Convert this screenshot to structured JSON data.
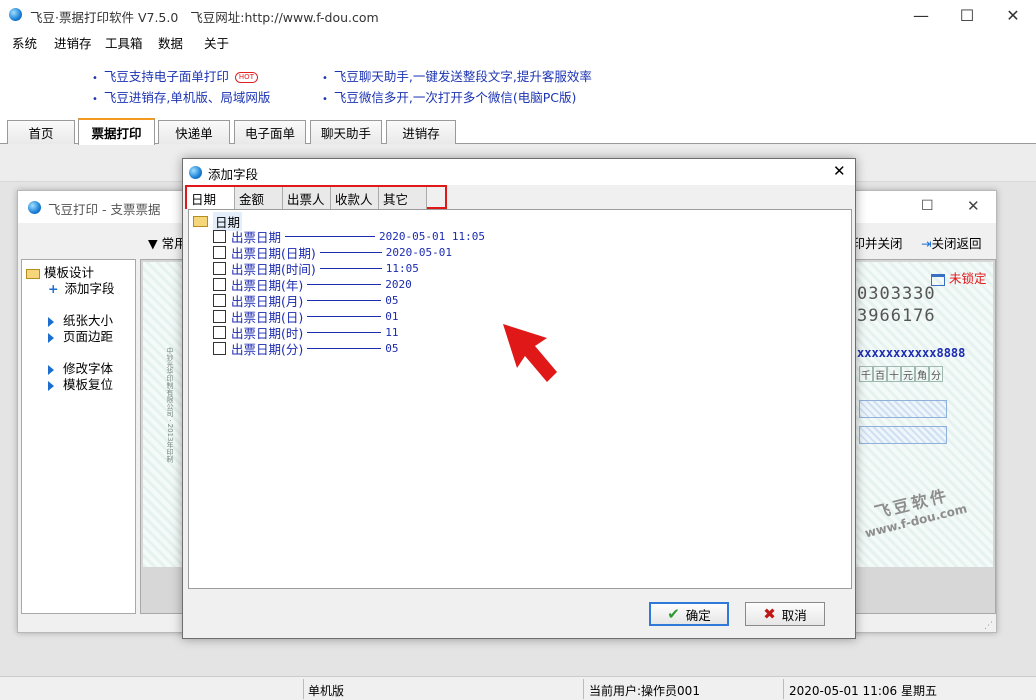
{
  "app": {
    "title": "飞豆·票据打印软件 V7.5.0",
    "site_label": "飞豆网址:http://www.f-dou.com"
  },
  "window_controls": {
    "minimize": "—",
    "maximize": "☐",
    "close": "✕"
  },
  "menu": [
    "系统",
    "进销存",
    "工具箱",
    "数据",
    "关于"
  ],
  "promo": {
    "items": [
      "飞豆支持电子面单打印",
      "飞豆进销存,单机版、局域网版",
      "飞豆聊天助手,一键发送整段文字,提升客服效率",
      "飞豆微信多开,一次打开多个微信(电脑PC版)"
    ],
    "hot_badge": "HOT"
  },
  "main_tabs": [
    "首页",
    "票据打印",
    "快递单",
    "电子面单",
    "聊天助手",
    "进销存"
  ],
  "active_tab": "票据打印",
  "bg_window": {
    "title": "飞豆打印 - 支票票据",
    "toolbar_left": "常用",
    "print_close": "打印并关闭",
    "close_return": "关闭返回",
    "unlocked": "未锁定",
    "left_panel": {
      "root": "模板设计",
      "add_field": "添加字段",
      "paper_size": "纸张大小",
      "page_margin": "页面边距",
      "change_font": "修改字体",
      "reset_template": "模板复位"
    },
    "ticket": {
      "number1": "0303330",
      "number2": "3966176",
      "account": "xxxxxxxxxxx8888",
      "amount_cols": [
        "千",
        "百",
        "十",
        "元",
        "角",
        "分"
      ],
      "printer_vertical": "中钞光华印制有限公司 · 2013年印制",
      "watermark_line1": "飞豆软件",
      "watermark_line2": "www.f-dou.com"
    }
  },
  "dialog": {
    "title": "添加字段",
    "tabs": [
      "日期",
      "金额",
      "出票人",
      "收款人",
      "其它"
    ],
    "root_node": "日期",
    "fields": [
      {
        "label": "出票日期",
        "value": "2020-05-01 11:05"
      },
      {
        "label": "出票日期(日期)",
        "value": "2020-05-01"
      },
      {
        "label": "出票日期(时间)",
        "value": "11:05"
      },
      {
        "label": "出票日期(年)",
        "value": "2020"
      },
      {
        "label": "出票日期(月)",
        "value": "05"
      },
      {
        "label": "出票日期(日)",
        "value": "01"
      },
      {
        "label": "出票日期(时)",
        "value": "11"
      },
      {
        "label": "出票日期(分)",
        "value": "05"
      }
    ],
    "ok": "确定",
    "cancel": "取消"
  },
  "status": {
    "edition": "单机版",
    "user": "当前用户:操作员001",
    "datetime": "2020-05-01  11:06 星期五"
  },
  "colors": {
    "accent_orange": "#f39a1e",
    "field_blue": "#1d2bb0",
    "highlight_red": "#e01818"
  }
}
